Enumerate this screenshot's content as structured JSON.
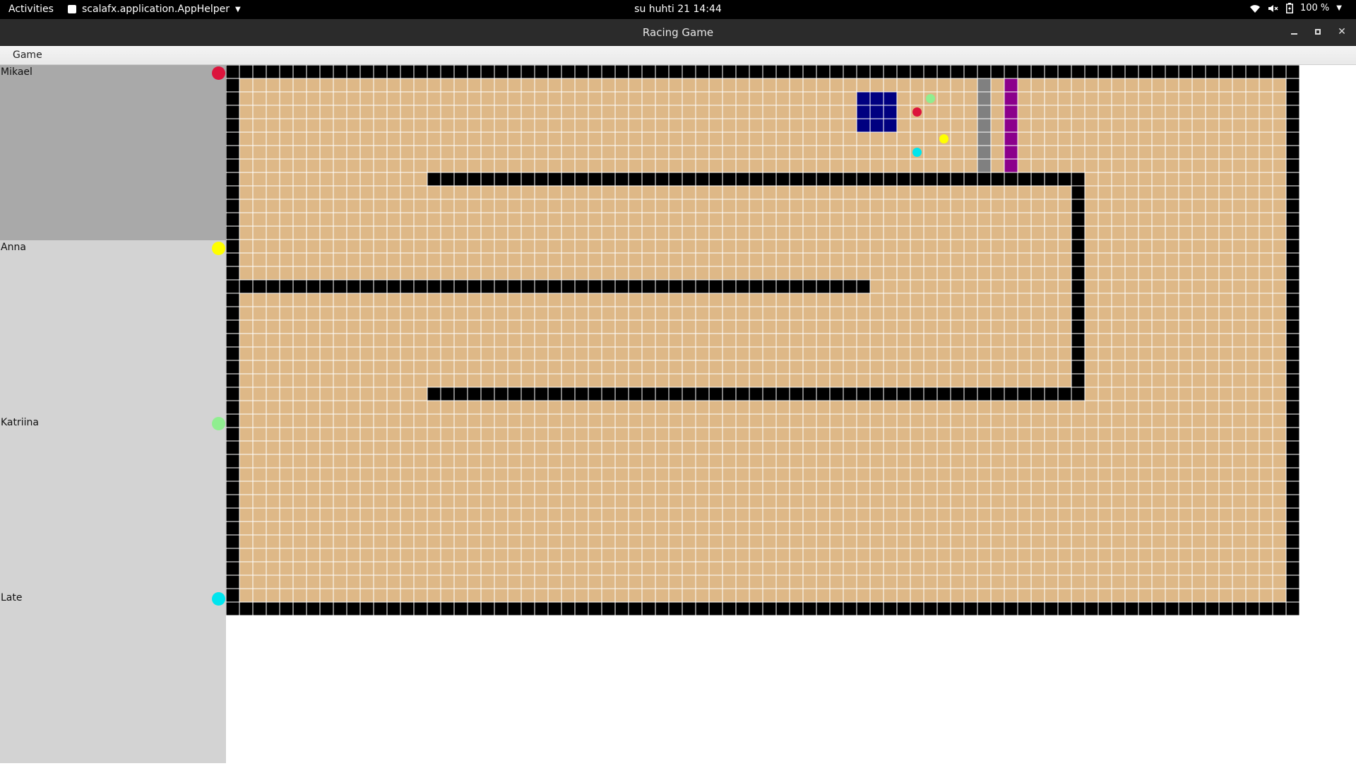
{
  "topbar": {
    "activities_label": "Activities",
    "app_name": "scalafx.application.AppHelper",
    "clock": "su huhti 21  14:44",
    "battery_level": "100 %",
    "icons": [
      "wifi-icon",
      "volume-muted-icon",
      "battery-icon",
      "chevron-down-icon"
    ]
  },
  "window": {
    "title": "Racing Game"
  },
  "menu": {
    "game_label": "Game"
  },
  "players": [
    {
      "name": "Mikael",
      "color": "#dc143c",
      "active": true
    },
    {
      "name": "Anna",
      "color": "#ffff00",
      "active": false
    },
    {
      "name": "Katriina",
      "color": "#90ee90",
      "active": false
    },
    {
      "name": "Late",
      "color": "#00e5ee",
      "active": false
    }
  ],
  "board": {
    "cols": 80,
    "rows": 40,
    "colors": {
      "track": "#deb887",
      "wall": "#000000",
      "grid_line": "#ffffff",
      "checkpoint": "#808080",
      "finish": "#8b008b",
      "start": "#000080"
    },
    "walls": [
      {
        "c0": 0,
        "c1": 79,
        "r0": 0,
        "r1": 0
      },
      {
        "c0": 0,
        "c1": 79,
        "r0": 40,
        "r1": 40
      },
      {
        "c0": 0,
        "c1": 0,
        "r0": 0,
        "r1": 40
      },
      {
        "c0": 79,
        "c1": 79,
        "r0": 0,
        "r1": 40
      },
      {
        "c0": 15,
        "c1": 63,
        "r0": 8,
        "r1": 8
      },
      {
        "c0": 63,
        "c1": 63,
        "r0": 8,
        "r1": 24
      },
      {
        "c0": 1,
        "c1": 47,
        "r0": 16,
        "r1": 16
      },
      {
        "c0": 15,
        "c1": 63,
        "r0": 24,
        "r1": 24
      }
    ],
    "checkpoint_line": {
      "col": 56,
      "r0": 1,
      "r1": 7
    },
    "finish_line": {
      "col": 58,
      "r0": 1,
      "r1": 7
    },
    "start_blocks": [
      {
        "col": 47,
        "row": 2
      },
      {
        "col": 48,
        "row": 2
      },
      {
        "col": 49,
        "row": 2
      },
      {
        "col": 47,
        "row": 3
      },
      {
        "col": 48,
        "row": 3
      },
      {
        "col": 49,
        "row": 3
      },
      {
        "col": 47,
        "row": 4
      },
      {
        "col": 48,
        "row": 4
      },
      {
        "col": 49,
        "row": 4
      }
    ],
    "cars": [
      {
        "player": "Mikael",
        "col": 51,
        "row": 3
      },
      {
        "player": "Katriina",
        "col": 52,
        "row": 2
      },
      {
        "player": "Anna",
        "col": 53,
        "row": 5
      },
      {
        "player": "Late",
        "col": 51,
        "row": 6
      }
    ]
  }
}
